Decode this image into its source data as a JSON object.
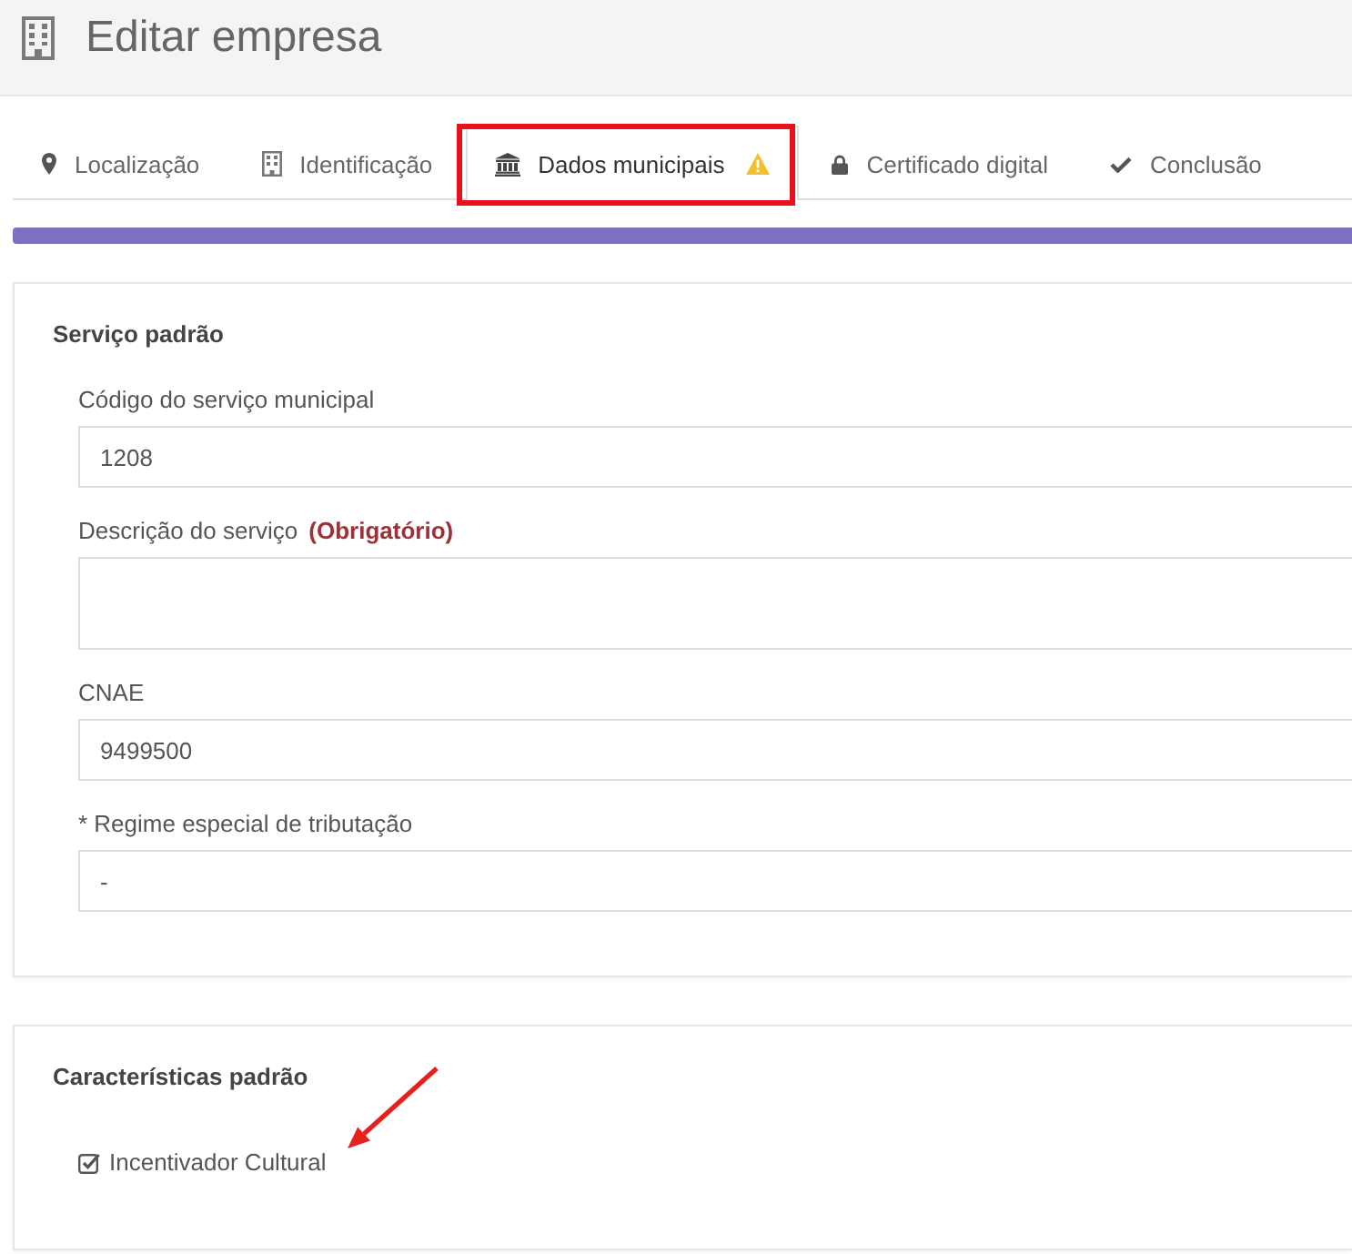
{
  "header": {
    "title": "Editar empresa"
  },
  "tabs": [
    {
      "label": "Localização",
      "selected": false,
      "warning": false
    },
    {
      "label": "Identificação",
      "selected": false,
      "warning": false
    },
    {
      "label": "Dados municipais",
      "selected": true,
      "warning": true
    },
    {
      "label": "Certificado digital",
      "selected": false,
      "warning": false
    },
    {
      "label": "Conclusão",
      "selected": false,
      "warning": false
    }
  ],
  "sections": [
    {
      "title": "Serviço padrão",
      "fields": [
        {
          "kind": "input",
          "label": "Código do serviço municipal",
          "value": "1208"
        },
        {
          "kind": "textarea",
          "label": "Descrição do serviço",
          "note": "(Obrigatório)"
        },
        {
          "kind": "input",
          "label": "CNAE",
          "value": "9499500"
        },
        {
          "kind": "input",
          "label": "* Regime especial de tributação",
          "value": "-"
        }
      ]
    },
    {
      "title": "Características padrão",
      "fields": [
        {
          "kind": "checkbox",
          "label": "Incentivador Cultural",
          "checked": true
        }
      ]
    }
  ]
}
